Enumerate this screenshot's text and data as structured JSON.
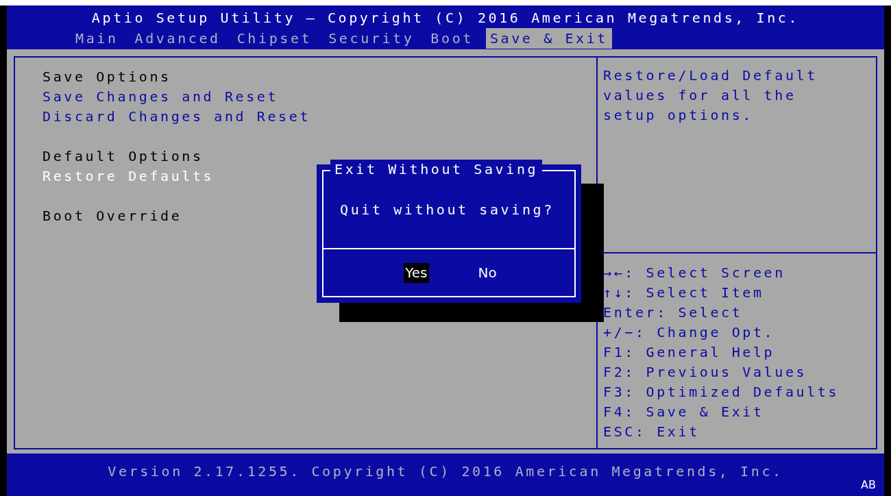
{
  "title": "Aptio Setup Utility – Copyright (C) 2016 American Megatrends, Inc.",
  "tabs": [
    {
      "label": "Main",
      "selected": false
    },
    {
      "label": "Advanced",
      "selected": false
    },
    {
      "label": "Chipset",
      "selected": false
    },
    {
      "label": "Security",
      "selected": false
    },
    {
      "label": "Boot",
      "selected": false
    },
    {
      "label": "Save & Exit",
      "selected": true
    }
  ],
  "menu": [
    {
      "kind": "header",
      "label": "Save Options"
    },
    {
      "kind": "action",
      "label": "Save Changes and Reset",
      "selected": false
    },
    {
      "kind": "action",
      "label": "Discard Changes and Reset",
      "selected": false
    },
    {
      "kind": "gap"
    },
    {
      "kind": "header",
      "label": "Default Options"
    },
    {
      "kind": "action",
      "label": "Restore Defaults",
      "selected": true
    },
    {
      "kind": "gap"
    },
    {
      "kind": "header",
      "label": "Boot Override"
    }
  ],
  "help": [
    "Restore/Load Default",
    "values for all the",
    "setup options."
  ],
  "keys": [
    "→←: Select Screen",
    "↑↓: Select Item",
    "Enter: Select",
    "+/−: Change Opt.",
    "F1: General Help",
    "F2: Previous Values",
    "F3: Optimized Defaults",
    "F4: Save & Exit",
    "ESC: Exit"
  ],
  "dialog": {
    "title": "Exit Without Saving",
    "message": "Quit without saving?",
    "buttons": [
      {
        "label": "Yes",
        "selected": true
      },
      {
        "label": "No",
        "selected": false
      }
    ]
  },
  "footer": {
    "version": "Version 2.17.1255. Copyright (C) 2016 American Megatrends, Inc.",
    "corner": "AB"
  }
}
